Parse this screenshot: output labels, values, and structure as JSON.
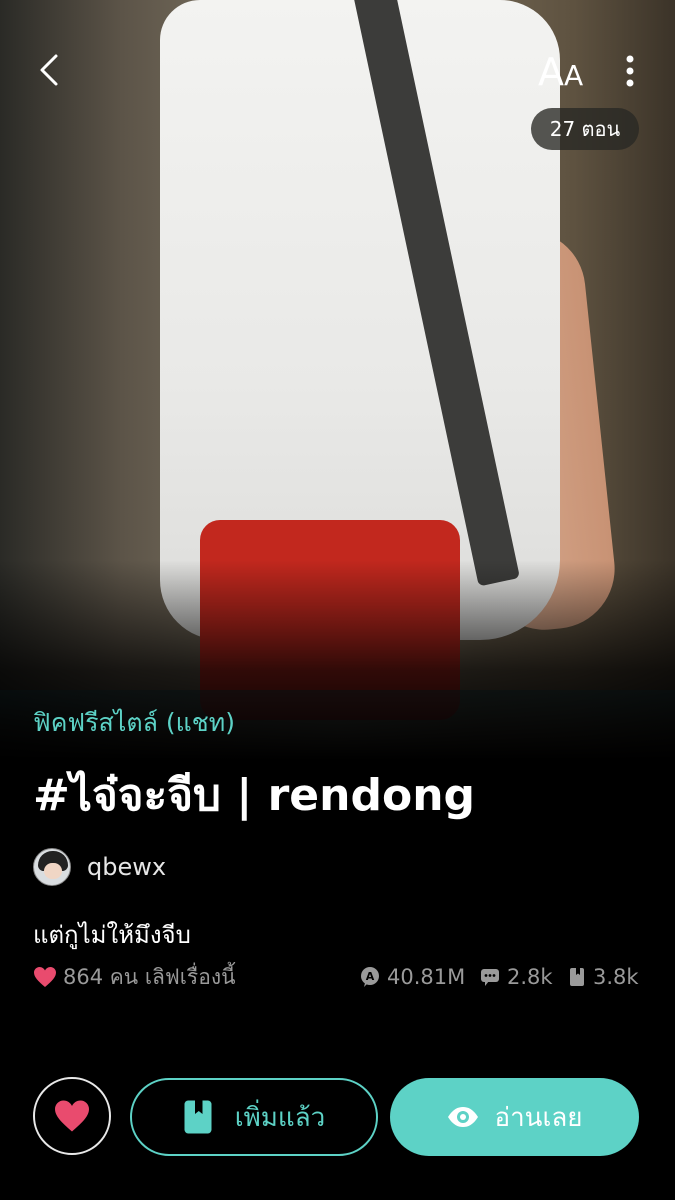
{
  "header": {
    "back_icon": "chevron-left-icon",
    "font_size_label_big": "A",
    "font_size_label_small": "A",
    "more_icon": "vertical-dots-icon",
    "episodes_label": "27 ตอน"
  },
  "story": {
    "category": "ฟิคฟรีสไตล์ (แชท)",
    "title": "#ไจ๋จะจีบ | rendong",
    "author": "qbewx",
    "description": "แต่กูไม่ให้มึงจีบ",
    "likes_text": "864 คน เลิฟเรื่องนี้",
    "views": "40.81M",
    "comments": "2.8k",
    "bookmarks": "3.8k"
  },
  "actions": {
    "library_label": "เพิ่มแล้ว",
    "read_label": "อ่านเลย"
  },
  "colors": {
    "accent": "#5dd2c6",
    "heart": "#e94b6e",
    "muted": "#9a9a9a"
  }
}
